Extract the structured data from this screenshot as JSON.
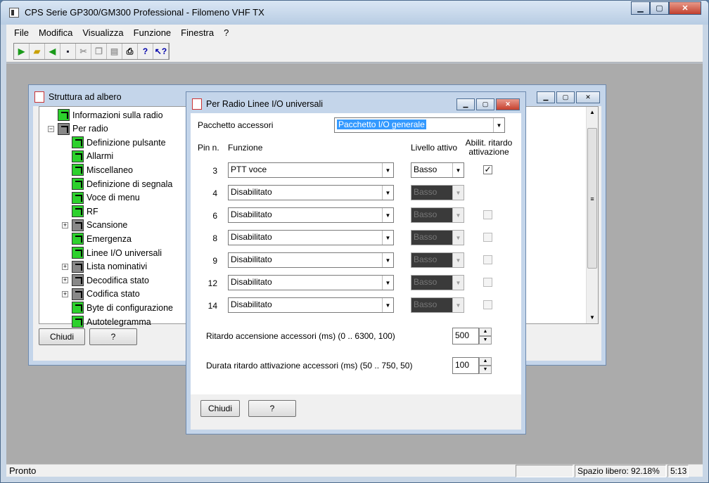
{
  "app": {
    "title": "CPS Serie GP300/GM300 Professional - Filomeno VHF TX"
  },
  "menu": [
    "File",
    "Modifica",
    "Visualizza",
    "Funzione",
    "Finestra",
    "?"
  ],
  "toolbar_icons": [
    "open-radio-icon",
    "open-folder-icon",
    "read-radio-icon",
    "save-icon",
    "cut-icon",
    "copy-icon",
    "paste-icon",
    "print-icon",
    "help-icon",
    "context-help-icon"
  ],
  "tree_window": {
    "title": "Struttura ad albero",
    "items": [
      {
        "label": "Informazioni sulla radio",
        "level": 1,
        "icon": "green",
        "exp": ""
      },
      {
        "label": "Per radio",
        "level": 1,
        "icon": "gray",
        "exp": "−"
      },
      {
        "label": "Definizione pulsante",
        "level": 2,
        "icon": "green",
        "exp": ""
      },
      {
        "label": "Allarmi",
        "level": 2,
        "icon": "green",
        "exp": ""
      },
      {
        "label": "Miscellaneo",
        "level": 2,
        "icon": "green",
        "exp": ""
      },
      {
        "label": "Definizione di segnala",
        "level": 2,
        "icon": "green",
        "exp": ""
      },
      {
        "label": "Voce di menu",
        "level": 2,
        "icon": "green",
        "exp": ""
      },
      {
        "label": "RF",
        "level": 2,
        "icon": "green",
        "exp": ""
      },
      {
        "label": "Scansione",
        "level": 2,
        "icon": "gray",
        "exp": "+"
      },
      {
        "label": "Emergenza",
        "level": 2,
        "icon": "green",
        "exp": ""
      },
      {
        "label": "Linee I/O universali",
        "level": 2,
        "icon": "green",
        "exp": ""
      },
      {
        "label": "Lista nominativi",
        "level": 2,
        "icon": "gray",
        "exp": "+"
      },
      {
        "label": "Decodifica stato",
        "level": 2,
        "icon": "gray",
        "exp": "+"
      },
      {
        "label": "Codifica stato",
        "level": 2,
        "icon": "gray",
        "exp": "+"
      },
      {
        "label": "Byte di configurazione",
        "level": 2,
        "icon": "green",
        "exp": ""
      },
      {
        "label": "Autotelegramma",
        "level": 2,
        "icon": "green",
        "exp": ""
      }
    ],
    "close_label": "Chiudi",
    "help_label": "?"
  },
  "dialog": {
    "title": "Per Radio Linee I/O universali",
    "accessory_label": "Pacchetto accessori",
    "accessory_value": "Pacchetto I/O generale",
    "col_pin": "Pin n.",
    "col_function": "Funzione",
    "col_level": "Livello attivo",
    "col_delay": "Abilit. ritardo attivazione",
    "rows": [
      {
        "pin": "3",
        "function": "PTT voce",
        "level": "Basso",
        "level_enabled": true,
        "delay_checked": true,
        "delay_shown": true
      },
      {
        "pin": "4",
        "function": "Disabilitato",
        "level": "Basso",
        "level_enabled": false,
        "delay_checked": false,
        "delay_shown": false
      },
      {
        "pin": "6",
        "function": "Disabilitato",
        "level": "Basso",
        "level_enabled": false,
        "delay_checked": false,
        "delay_shown": true
      },
      {
        "pin": "8",
        "function": "Disabilitato",
        "level": "Basso",
        "level_enabled": false,
        "delay_checked": false,
        "delay_shown": true
      },
      {
        "pin": "9",
        "function": "Disabilitato",
        "level": "Basso",
        "level_enabled": false,
        "delay_checked": false,
        "delay_shown": true
      },
      {
        "pin": "12",
        "function": "Disabilitato",
        "level": "Basso",
        "level_enabled": false,
        "delay_checked": false,
        "delay_shown": true
      },
      {
        "pin": "14",
        "function": "Disabilitato",
        "level": "Basso",
        "level_enabled": false,
        "delay_checked": false,
        "delay_shown": true
      }
    ],
    "power_delay_label": "Ritardo accensione accessori (ms) (0 .. 6300, 100)",
    "power_delay_value": "500",
    "activation_delay_label": "Durata ritardo attivazione accessori (ms) (50 .. 750, 50)",
    "activation_delay_value": "100",
    "close_label": "Chiudi",
    "help_label": "?"
  },
  "status": {
    "left": "Pronto",
    "free_space": "Spazio libero: 92.18%",
    "time": "5:13"
  }
}
